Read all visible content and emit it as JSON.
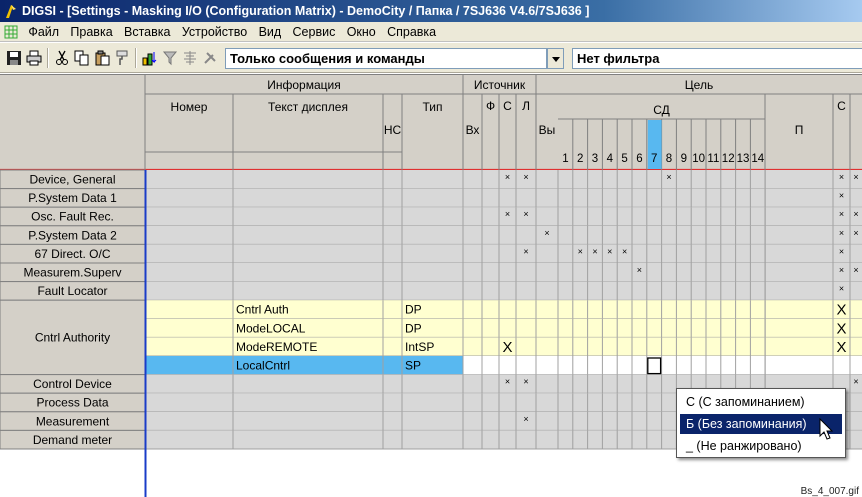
{
  "titlebar": {
    "title": "DIGSI - [Settings - Masking I/O (Configuration Matrix) - DemoCity / Папка / 7SJ636 V4.6/7SJ636 ]"
  },
  "menu": {
    "items": [
      "Файл",
      "Правка",
      "Вставка",
      "Устройство",
      "Вид",
      "Сервис",
      "Окно",
      "Справка"
    ]
  },
  "toolbar": {
    "filter1": "Только сообщения и команды",
    "filter2": "Нет фильтра"
  },
  "matrix": {
    "groups": {
      "info": "Информация",
      "source": "Источник",
      "target": "Цель"
    },
    "columns": {
      "number": "Номер",
      "display_text": "Текст дисплея",
      "nc": "НС",
      "type": "Тип",
      "bi": "Вх",
      "f": "Ф",
      "c": "С",
      "l": "Л",
      "bo": "Вы",
      "ld": "СД",
      "p": "П",
      "s": "С"
    },
    "ld_numbers": [
      "1",
      "2",
      "3",
      "4",
      "5",
      "6",
      "7",
      "8",
      "9",
      "10",
      "11",
      "12",
      "13",
      "14"
    ],
    "selected_ld_column": "7",
    "mark_small": "×",
    "mark_big": "X",
    "rows": [
      {
        "name": "Device, General",
        "type": "",
        "text": "",
        "marks": [
          "C",
          "L",
          "LD8",
          "S",
          "S2"
        ]
      },
      {
        "name": "P.System Data 1",
        "type": "",
        "text": "",
        "marks": [
          "S"
        ]
      },
      {
        "name": "Osc. Fault Rec.",
        "type": "",
        "text": "",
        "marks": [
          "C",
          "L",
          "S",
          "S2"
        ]
      },
      {
        "name": "P.System Data 2",
        "type": "",
        "text": "",
        "marks": [
          "BO",
          "S",
          "S2"
        ]
      },
      {
        "name": "67 Direct. O/C",
        "type": "",
        "text": "",
        "marks": [
          "L",
          "LD2",
          "LD3",
          "LD4",
          "LD5",
          "S"
        ]
      },
      {
        "name": "Measurem.Superv",
        "type": "",
        "text": "",
        "marks": [
          "LD6",
          "S",
          "S2"
        ]
      },
      {
        "name": "Fault Locator",
        "type": "",
        "text": "",
        "marks": [
          "S"
        ]
      },
      {
        "name": "Cntrl Authority",
        "type": "",
        "text": "",
        "group": true
      },
      {
        "name": "",
        "text": "Cntrl Auth",
        "type": "DP",
        "sub": true,
        "marks": [
          "SX"
        ]
      },
      {
        "name": "",
        "text": "ModeLOCAL",
        "type": "DP",
        "sub": true,
        "marks": [
          "SX"
        ]
      },
      {
        "name": "",
        "text": "ModeREMOTE",
        "type": "IntSP",
        "sub": true,
        "marks": [
          "CX",
          "SX"
        ]
      },
      {
        "name": "",
        "text": "LocalCntrl",
        "type": "SP",
        "sub": true,
        "selected": true,
        "marks": []
      },
      {
        "name": "Control Device",
        "type": "",
        "text": "",
        "marks": [
          "C",
          "L",
          "S2"
        ]
      },
      {
        "name": "Process Data",
        "type": "",
        "text": "",
        "marks": []
      },
      {
        "name": "Measurement",
        "type": "",
        "text": "",
        "marks": [
          "L"
        ]
      },
      {
        "name": "Demand meter",
        "type": "",
        "text": "",
        "marks": []
      }
    ]
  },
  "popup": {
    "items": [
      "С (С запоминанием)",
      "Б (Без запоминания)",
      "_ (Не ранжировано)"
    ],
    "selected_index": 1
  },
  "caption": "Bs_4_007.gif",
  "colors": {
    "header_bg": "#d4d0c8",
    "cell_bg": "#d8d8d8",
    "info_bg": "#ffffd0",
    "selected_row": "#58b8f0",
    "selected_col": "#58b8f0",
    "title_bar": "#0a246a"
  }
}
